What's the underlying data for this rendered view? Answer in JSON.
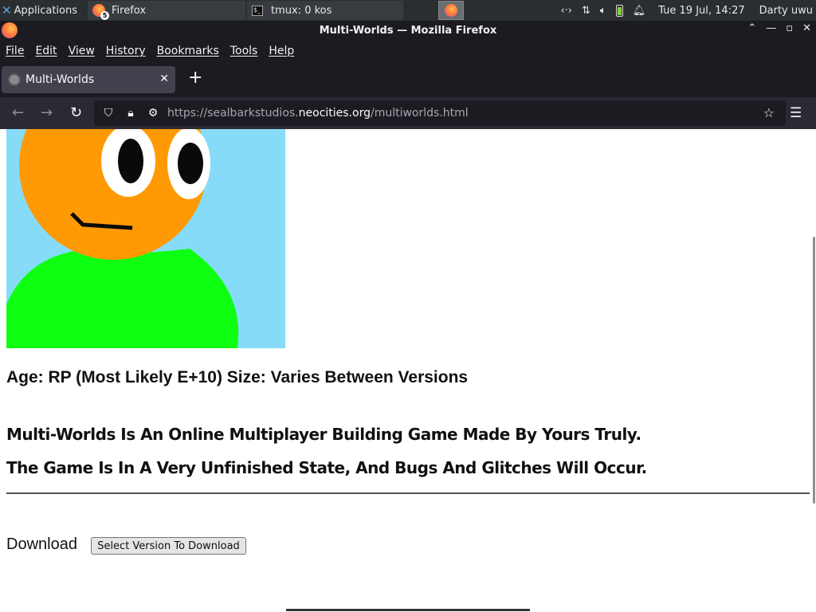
{
  "system_panel": {
    "applications_label": "Applications",
    "tasks": [
      {
        "label": "Firefox",
        "badge": "5"
      },
      {
        "label": "tmux: 0 kos"
      }
    ],
    "clock": "Tue 19 Jul, 14:27",
    "user": "Darty uwu"
  },
  "window": {
    "title": "Multi-Worlds — Mozilla Firefox"
  },
  "menu": {
    "items": [
      "File",
      "Edit",
      "View",
      "History",
      "Bookmarks",
      "Tools",
      "Help"
    ]
  },
  "tabs": [
    {
      "label": "Multi-Worlds"
    }
  ],
  "url": {
    "prefix": "https://sealbarkstudios.",
    "host": "neocities.org",
    "suffix": "/multiworlds.html"
  },
  "page": {
    "age_line": "Age: RP (Most Likely E+10) Size: Varies Between Versions",
    "desc_lines": [
      "Multi-Worlds Is An Online Multiplayer Building Game Made By Yours Truly.",
      "The Game Is In A Very Unfinished State, And Bugs And Glitches Will Occur."
    ],
    "download_label": "Download",
    "download_button": "Select Version To Download"
  },
  "colors": {
    "picture_sky": "#86dcf8",
    "character_head": "#ff9a05",
    "character_body": "#0fff12"
  }
}
